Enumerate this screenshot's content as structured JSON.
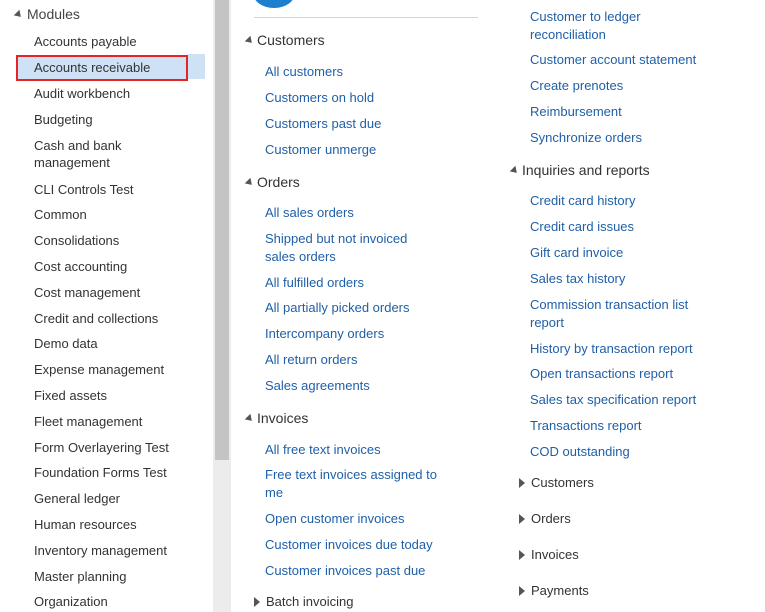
{
  "modules": {
    "header": "Modules",
    "items": [
      "Accounts payable",
      "Accounts receivable",
      "Audit workbench",
      "Budgeting",
      "Cash and bank management",
      "CLI Controls Test",
      "Common",
      "Consolidations",
      "Cost accounting",
      "Cost management",
      "Credit and collections",
      "Demo data",
      "Expense management",
      "Fixed assets",
      "Fleet management",
      "Form Overlayering Test",
      "Foundation Forms Test",
      "General ledger",
      "Human resources",
      "Inventory management",
      "Master planning",
      "Organization"
    ],
    "selected": "Accounts receivable"
  },
  "customers": {
    "header": "Customers",
    "links": [
      "All customers",
      "Customers on hold",
      "Customers past due",
      "Customer unmerge"
    ]
  },
  "orders": {
    "header": "Orders",
    "links": [
      "All sales orders",
      "Shipped but not invoiced sales orders",
      "All fulfilled orders",
      "All partially picked orders",
      "Intercompany orders",
      "All return orders",
      "Sales agreements"
    ]
  },
  "invoices": {
    "header": "Invoices",
    "links": [
      "All free text invoices",
      "Free text invoices assigned to me",
      "Open customer invoices",
      "Customer invoices due today",
      "Customer invoices past due"
    ]
  },
  "batch_invoicing": {
    "header": "Batch invoicing"
  },
  "periodic_tasks": {
    "links": [
      "Customer to ledger reconciliation",
      "Customer account statement",
      "Create prenotes",
      "Reimbursement",
      "Synchronize orders"
    ]
  },
  "inquiries": {
    "header": "Inquiries and reports",
    "links": [
      "Credit card history",
      "Credit card issues",
      "Gift card invoice",
      "Sales tax history",
      "Commission transaction list report",
      "History by transaction report",
      "Open transactions report",
      "Sales tax specification report",
      "Transactions report",
      "COD outstanding"
    ]
  },
  "collapsed_groups": [
    "Customers",
    "Orders",
    "Invoices",
    "Payments"
  ]
}
